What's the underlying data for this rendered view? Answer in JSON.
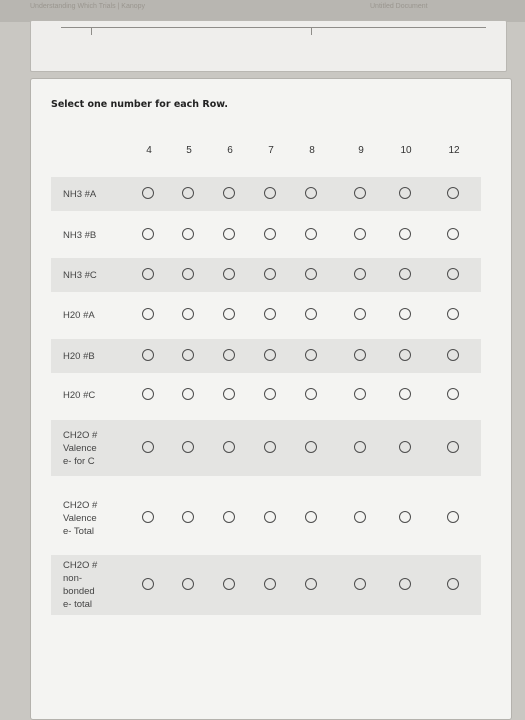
{
  "browser": {
    "tab_left": "Understanding Which Trials | Kanopy",
    "tab_right": "Untitled Document"
  },
  "form": {
    "instruction": "Select one number for each Row.",
    "columns": [
      "4",
      "5",
      "6",
      "7",
      "8",
      "9",
      "10",
      "12"
    ],
    "rows": [
      {
        "label": "NH3 #A"
      },
      {
        "label": "NH3 #B"
      },
      {
        "label": "NH3 #C"
      },
      {
        "label": "H20 #A"
      },
      {
        "label": "H20 #B"
      },
      {
        "label": "H20 #C"
      },
      {
        "label": "CH2O # Valence e- for C"
      },
      {
        "label": "CH2O # Valence e- Total"
      },
      {
        "label": "CH2O # non-bonded e- total"
      }
    ],
    "selected": [
      null,
      null,
      null,
      null,
      null,
      null,
      null,
      null,
      null
    ]
  }
}
